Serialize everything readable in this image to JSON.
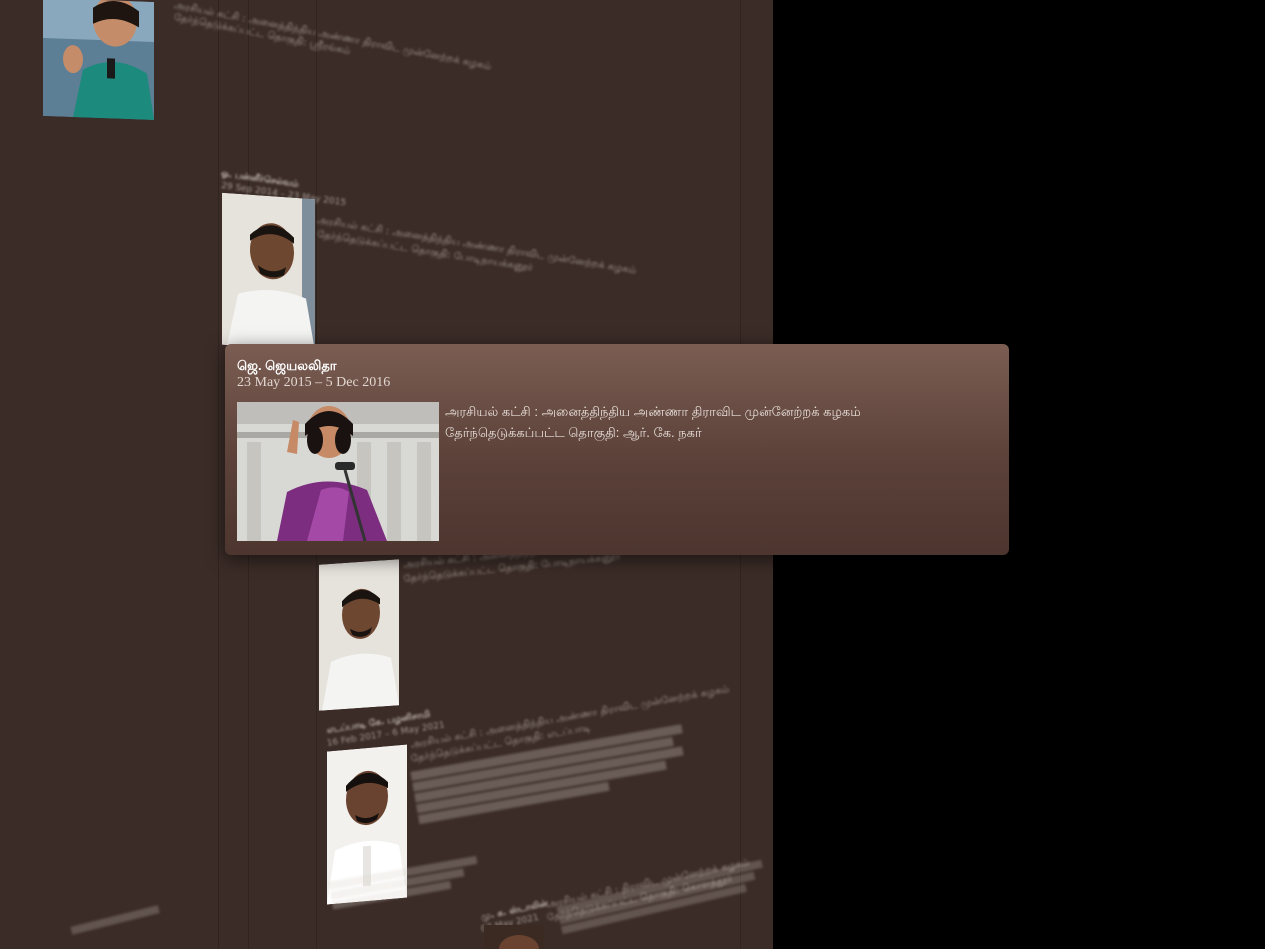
{
  "focused_entry": {
    "name": "ஜெ. ஜெயலலிதா",
    "dates": "23 May 2015 – 5 Dec 2016",
    "party": "அரசியல் கட்சி : அனைத்திந்திய அண்ணா திராவிட முன்னேற்றக் கழகம்",
    "constituency": "தேர்ந்தெடுக்கப்பட்ட தொகுதி: ஆர். கே. நகர்"
  },
  "background_entries": [
    {
      "name": "ஓ. பன்னீர்செல்வம்",
      "dates": "29 Sep 2014 – 23 May 2015",
      "party": "அரசியல் கட்சி : அனைத்திந்திய அண்ணா திராவிட முன்னேற்றக் கழகம்",
      "constituency": "தேர்ந்தெடுக்கப்பட்ட தொகுதி: போடிநாயக்கனூர்"
    },
    {
      "party": "அரசியல் கட்சி : அனைத்திந்திய அண்ணா திராவிட முன்னேற்றக் கழகம்",
      "constituency": "தேர்ந்தெடுக்கப்பட்ட தொகுதி: போடிநாயக்கனூர்"
    },
    {
      "name": "எடப்பாடி கே. பழனிசாமி",
      "dates": "16 Feb 2017 – 6 May 2021",
      "party": "அரசியல் கட்சி : அனைத்திந்திய அண்ணா திராவிட முன்னேற்றக் கழகம்",
      "constituency": "தேர்ந்தெடுக்கப்பட்ட தொகுதி: எடப்பாடி"
    },
    {
      "name": "மு. க. ஸ்டாலின்",
      "dates": "07 May 2021",
      "party": "அரசியல் கட்சி : திராவிட முன்னேற்றக் கழகம்",
      "constituency": "தேர்ந்தெடுக்கப்பட்ட தொகுதி: கொளத்தூர்"
    }
  ],
  "top_entry": {
    "party": "அரசியல் கட்சி : அனைத்திந்திய அண்ணா திராவிட முன்னேற்றக் கழகம்",
    "constituency": "தேர்ந்தெடுக்கப்பட்ட தொகுதி: ஸ்ரீரங்கம்"
  },
  "colors": {
    "background": "#000000",
    "panel": "#3b2c27",
    "card_top": "#7b5d52",
    "card_bottom": "#4d362f"
  }
}
